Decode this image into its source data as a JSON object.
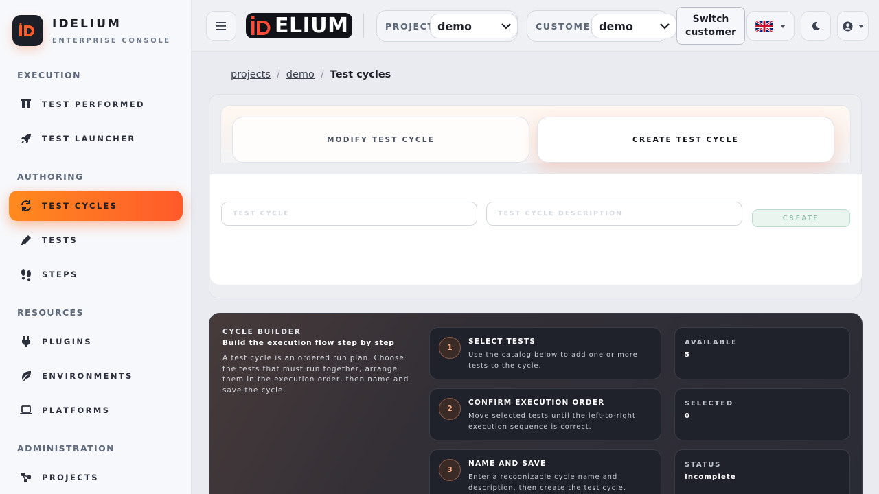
{
  "brand": {
    "name": "IDELIUM",
    "subtitle": "ENTERPRISE CONSOLE"
  },
  "sidebar": {
    "sections": [
      {
        "title": "EXECUTION",
        "items": [
          {
            "label": "TEST PERFORMED",
            "icon": "flask-icon"
          },
          {
            "label": "TEST LAUNCHER",
            "icon": "rocket-icon"
          }
        ]
      },
      {
        "title": "AUTHORING",
        "items": [
          {
            "label": "TEST CYCLES",
            "icon": "cycle-icon",
            "active": true
          },
          {
            "label": "TESTS",
            "icon": "pencil-icon"
          },
          {
            "label": "STEPS",
            "icon": "footprints-icon"
          }
        ]
      },
      {
        "title": "RESOURCES",
        "items": [
          {
            "label": "PLUGINS",
            "icon": "plug-icon"
          },
          {
            "label": "ENVIRONMENTS",
            "icon": "leaf-icon"
          },
          {
            "label": "PLATFORMS",
            "icon": "laptop-icon"
          }
        ]
      },
      {
        "title": "ADMINISTRATION",
        "items": [
          {
            "label": "PROJECTS",
            "icon": "network-icon"
          }
        ]
      }
    ]
  },
  "header": {
    "logo_text": "ELIUM",
    "project_label": "PROJECT",
    "project_value": "demo",
    "customer_label": "CUSTOMER",
    "customer_value": "demo",
    "switch_line1": "Switch",
    "switch_line2": "customer"
  },
  "breadcrumb": {
    "items": [
      "projects",
      "demo"
    ],
    "current": "Test cycles"
  },
  "tabs": {
    "modify": "MODIFY TEST CYCLE",
    "create": "CREATE TEST CYCLE"
  },
  "form": {
    "name_placeholder": "TEST CYCLE",
    "desc_placeholder": "TEST CYCLE DESCRIPTION",
    "create_label": "CREATE"
  },
  "builder": {
    "title": "CYCLE BUILDER",
    "subtitle": "Build the execution flow step by step",
    "description": "A test cycle is an ordered run plan. Choose the tests that must run together, arrange them in the execution order, then name and save the cycle.",
    "steps": [
      {
        "num": "1",
        "title": "SELECT TESTS",
        "desc": "Use the catalog below to add one or more tests to the cycle."
      },
      {
        "num": "2",
        "title": "CONFIRM EXECUTION ORDER",
        "desc": "Move selected tests until the left-to-right execution sequence is correct."
      },
      {
        "num": "3",
        "title": "NAME AND SAVE",
        "desc": "Enter a recognizable cycle name and description, then create the test cycle."
      }
    ],
    "stats": [
      {
        "label": "AVAILABLE",
        "value": "5"
      },
      {
        "label": "SELECTED",
        "value": "0"
      },
      {
        "label": "STATUS",
        "value": "Incomplete"
      }
    ]
  },
  "colors": {
    "accent": "#ff6a25",
    "logo_red": "#ff4b3a"
  }
}
